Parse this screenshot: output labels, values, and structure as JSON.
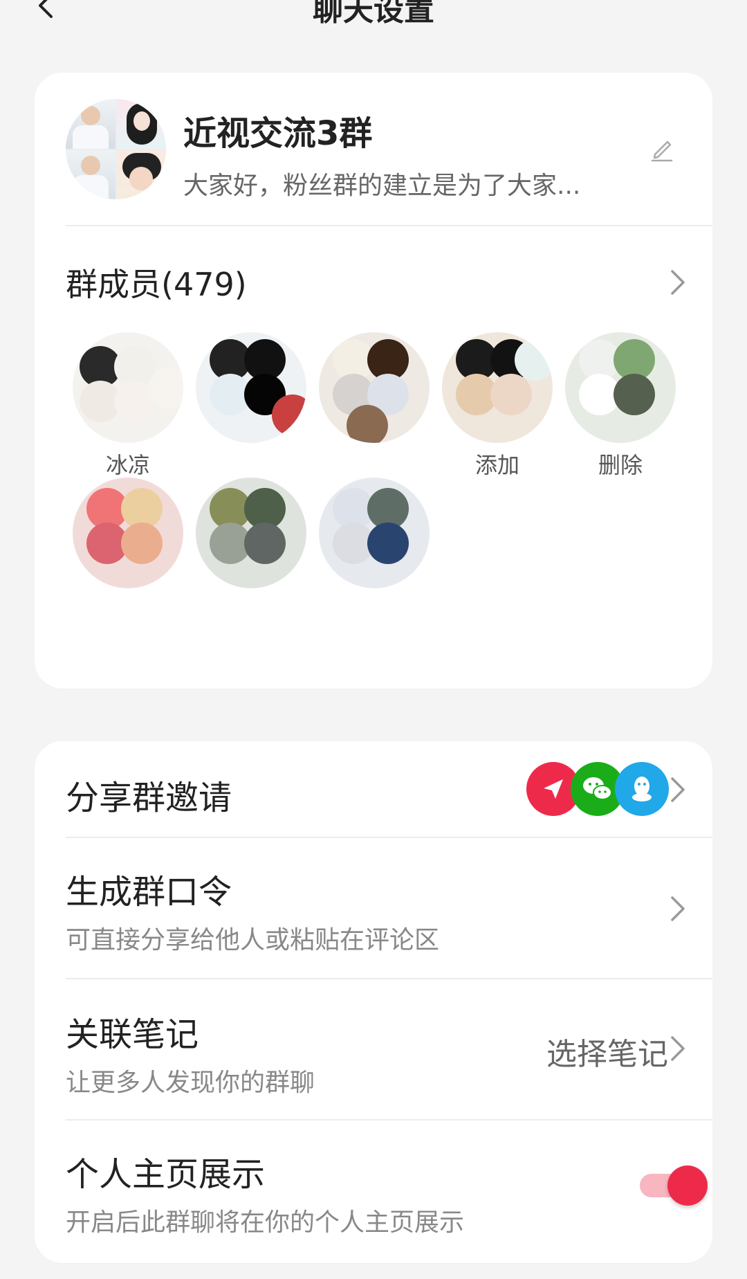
{
  "header": {
    "title": "聊天设置"
  },
  "group": {
    "name": "近视交流3群",
    "description": "大家好，粉丝群的建立是为了大家..."
  },
  "members": {
    "title": "群成员(479)",
    "items": [
      {
        "label": "冰凉"
      },
      {
        "label": ""
      },
      {
        "label": ""
      },
      {
        "label": "添加"
      },
      {
        "label": "删除"
      }
    ]
  },
  "rows": {
    "share": {
      "title": "分享群邀请",
      "icons": [
        "send-icon",
        "wechat-icon",
        "qq-icon"
      ]
    },
    "password": {
      "title": "生成群口令",
      "subtitle": "可直接分享给他人或粘贴在评论区"
    },
    "note": {
      "title": "关联笔记",
      "subtitle": "让更多人发现你的群聊",
      "value": "选择笔记"
    },
    "profile": {
      "title": "个人主页展示",
      "subtitle": "开启后此群聊将在你的个人主页展示",
      "enabled": true
    }
  },
  "colors": {
    "accent": "#ee2a4b",
    "wechat": "#1aad19",
    "qq": "#20a8e8"
  }
}
